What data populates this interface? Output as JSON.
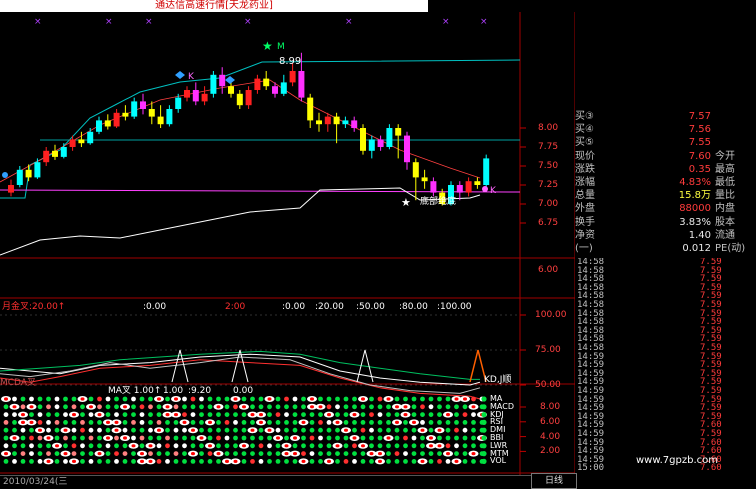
{
  "window": {
    "title": "通达信高速行情[天龙药业]"
  },
  "main_chart": {
    "price_axis": [
      "8.00",
      "7.75",
      "7.50",
      "7.25",
      "7.00",
      "6.75"
    ],
    "peak_label": "8.99",
    "peak_marker": "M",
    "k_marker_left": "K",
    "k_marker_right": "K",
    "bottom_signal": "底部绝底"
  },
  "quote_panel": {
    "rows": [
      {
        "label": "买③",
        "value": "7.57",
        "side_label": ""
      },
      {
        "label": "买④",
        "value": "7.56",
        "side_label": ""
      },
      {
        "label": "买⑤",
        "value": "7.55",
        "side_label": ""
      },
      {
        "label": "现价",
        "value": "7.60",
        "side_label": "今开"
      },
      {
        "label": "涨跌",
        "value": "0.35",
        "side_label": "最高"
      },
      {
        "label": "涨幅",
        "value": "4.83%",
        "side_label": "最低"
      },
      {
        "label": "总量",
        "value": "15.8万",
        "side_label": "量比"
      },
      {
        "label": "外盘",
        "value": "88000",
        "side_label": "内盘"
      },
      {
        "label": "换手",
        "value": "3.83%",
        "side_label": "股本"
      },
      {
        "label": "净资",
        "value": "1.40",
        "side_label": "流通"
      },
      {
        "label": "(一)",
        "value": "0.012",
        "side_label": "PE(动)"
      }
    ]
  },
  "volume_axis": {
    "value": "6.00"
  },
  "indicator1": {
    "title": "月金叉:20.00↑",
    "params": [
      ":0.00",
      "2:00",
      ":0.00",
      ":20.00",
      ":50.00",
      ":80.00",
      ":100.00"
    ],
    "axis": [
      "100.00",
      "75.00",
      "50.00"
    ],
    "signal_text": "KD,J顺"
  },
  "indicator2": {
    "overlay_text": "MCDA叉",
    "title": "MA叉 1.00↑",
    "extra_values": [
      "1.00",
      ":9.20",
      "0.00"
    ],
    "axis": [
      "8.00",
      "6.00",
      "4.00",
      "2.00"
    ],
    "labels": [
      "MA",
      "MACD",
      "KDJ",
      "RSI",
      "DMI",
      "BBI",
      "LWR",
      "MTM",
      "VOL"
    ]
  },
  "ticks": [
    {
      "time": "14:58",
      "price": "7.59"
    },
    {
      "time": "14:58",
      "price": "7.59"
    },
    {
      "time": "14:58",
      "price": "7.59"
    },
    {
      "time": "14:58",
      "price": "7.59"
    },
    {
      "time": "14:58",
      "price": "7.59"
    },
    {
      "time": "14:58",
      "price": "7.59"
    },
    {
      "time": "14:58",
      "price": "7.59"
    },
    {
      "time": "14:58",
      "price": "7.59"
    },
    {
      "time": "14:58",
      "price": "7.59"
    },
    {
      "time": "14:58",
      "price": "7.59"
    },
    {
      "time": "14:58",
      "price": "7.59"
    },
    {
      "time": "14:59",
      "price": "7.59"
    },
    {
      "time": "14:59",
      "price": "7.59"
    },
    {
      "time": "14:59",
      "price": "7.59"
    },
    {
      "time": "14:59",
      "price": "7.59"
    },
    {
      "time": "14:59",
      "price": "7.59"
    },
    {
      "time": "14:59",
      "price": "7.59"
    },
    {
      "time": "14:59",
      "price": "7.59"
    },
    {
      "time": "14:59",
      "price": "7.59"
    },
    {
      "time": "14:59",
      "price": "7.60"
    },
    {
      "time": "14:59",
      "price": "7.59"
    },
    {
      "time": "14:59",
      "price": "7.60"
    },
    {
      "time": "14:59",
      "price": "7.60"
    },
    {
      "time": "14:59",
      "price": "7.60"
    },
    {
      "time": "15:00",
      "price": "7.60"
    }
  ],
  "bottom": {
    "date": "2010/03/24(三",
    "tabs": [
      "日线"
    ]
  },
  "watermark": "www.7gpzb.com"
}
